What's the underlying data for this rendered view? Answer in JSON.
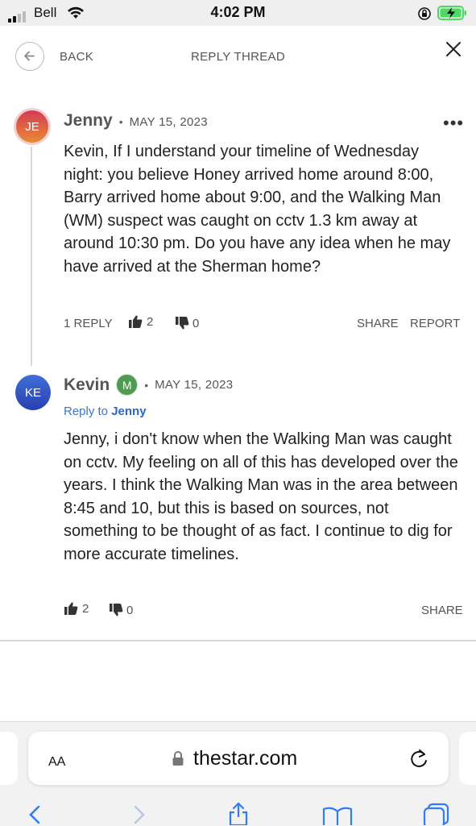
{
  "status_bar": {
    "carrier": "Bell",
    "time": "4:02 PM"
  },
  "header": {
    "back_label": "BACK",
    "title": "REPLY THREAD"
  },
  "comments": [
    {
      "initials": "JE",
      "author": "Jenny",
      "separator": "•",
      "date": "MAY 15, 2023",
      "text": "Kevin, If I understand your timeline of Wednesday night: you believe Honey arrived home around 8:00, Barry arrived home about 9:00, and the Walking Man (WM) suspect was caught on cctv 1.3 km away at around 10:30 pm. Do you have any idea when he may have arrived at the Sherman home?",
      "reply_label": "1 REPLY",
      "likes": "2",
      "dislikes": "0",
      "share_label": "SHARE",
      "report_label": "REPORT",
      "avatar_colors": [
        "#d63a55",
        "#e88a35"
      ]
    },
    {
      "initials": "KE",
      "author": "Kevin",
      "badge": "M",
      "separator": "•",
      "date": "MAY 15, 2023",
      "reply_to_prefix": "Reply to",
      "reply_to_name": "Jenny",
      "text": "Jenny, i don't know when the Walking Man was caught on cctv. My feeling on all of this has developed over the years. I think the Walking Man was in the area between 8:45 and 10, but this is based on sources, not something to be thought of as fact. I continue to dig for more accurate timelines.",
      "likes": "2",
      "dislikes": "0",
      "share_label": "SHARE",
      "avatar_colors": [
        "#3f6fd6",
        "#2a3fb0"
      ],
      "badge_color": "#4f9b54"
    }
  ],
  "browser": {
    "text_size_label": "AA",
    "url": "thestar.com"
  },
  "colors": {
    "link": "#3a76d0",
    "battery": "#4cd964"
  }
}
